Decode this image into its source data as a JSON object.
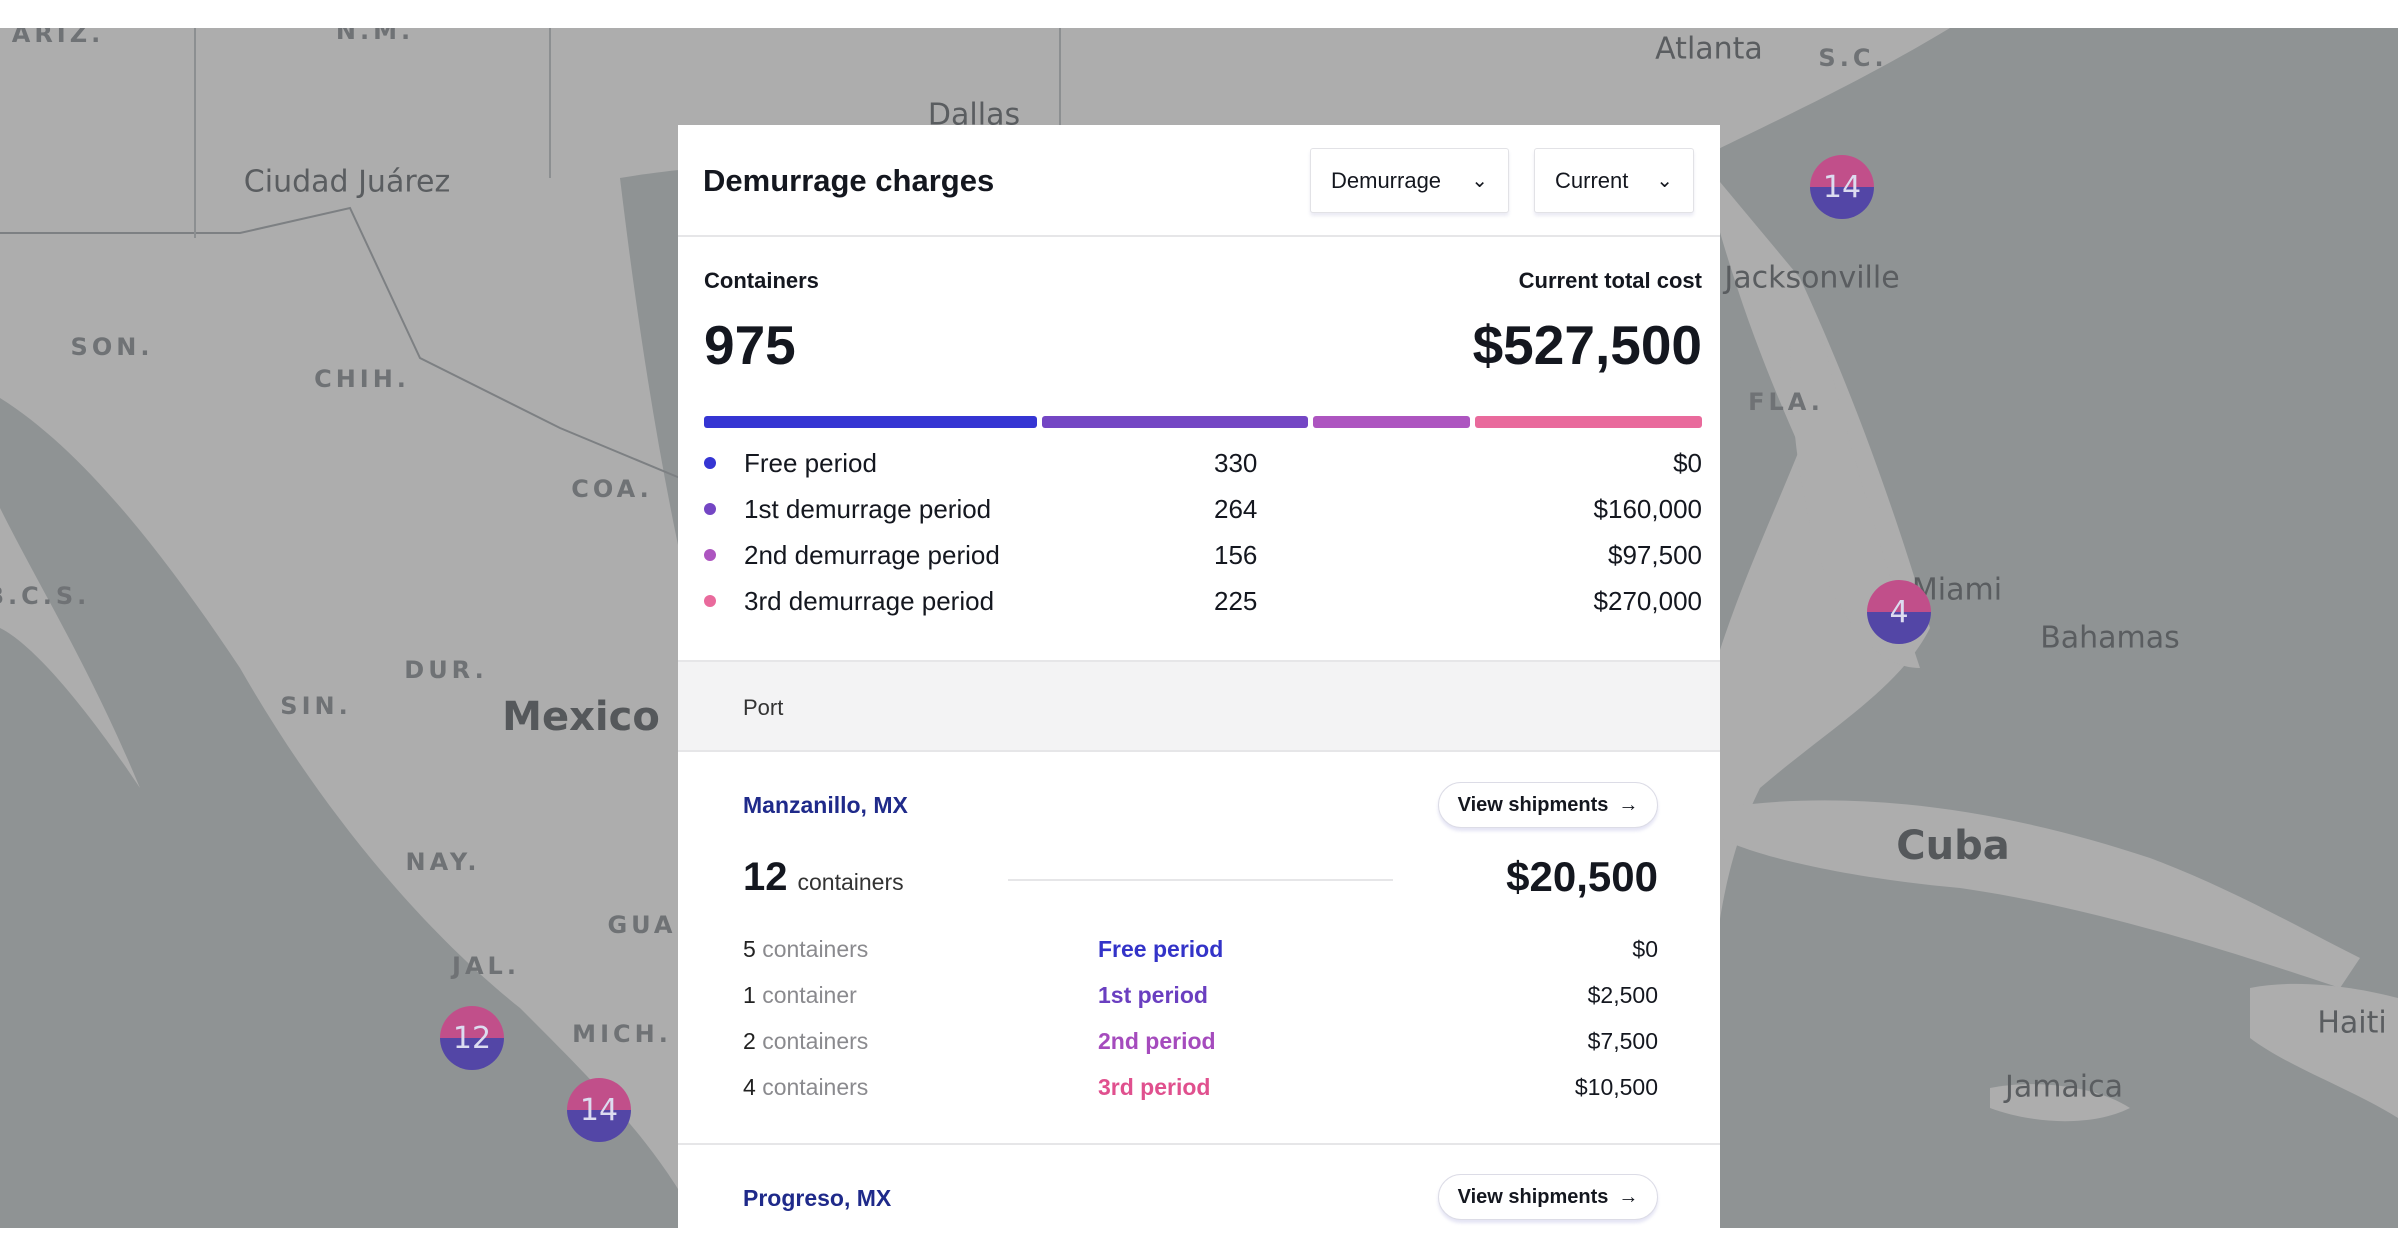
{
  "map": {
    "labels": [
      {
        "text": "ARIZ.",
        "kind": "state"
      },
      {
        "text": "N.M.",
        "kind": "state"
      },
      {
        "text": "Dallas",
        "kind": "city"
      },
      {
        "text": "Atlanta",
        "kind": "city"
      },
      {
        "text": "S.C.",
        "kind": "state"
      },
      {
        "text": "Ciudad Juárez",
        "kind": "city"
      },
      {
        "text": "Jacksonville",
        "kind": "city"
      },
      {
        "text": "SON.",
        "kind": "state"
      },
      {
        "text": "CHIH.",
        "kind": "state"
      },
      {
        "text": "FLA.",
        "kind": "state"
      },
      {
        "text": "COA.",
        "kind": "state"
      },
      {
        "text": "B.C.S.",
        "kind": "state"
      },
      {
        "text": "Miami",
        "kind": "city"
      },
      {
        "text": "Bahamas",
        "kind": "city"
      },
      {
        "text": "DUR.",
        "kind": "state"
      },
      {
        "text": "SIN.",
        "kind": "state"
      },
      {
        "text": "Mexico",
        "kind": "country"
      },
      {
        "text": "Cuba",
        "kind": "country"
      },
      {
        "text": "NAY.",
        "kind": "state"
      },
      {
        "text": "GUA",
        "kind": "state"
      },
      {
        "text": "JAL.",
        "kind": "state"
      },
      {
        "text": "MICH.",
        "kind": "state"
      },
      {
        "text": "Haiti",
        "kind": "city"
      },
      {
        "text": "Jamaica",
        "kind": "city"
      }
    ],
    "clusters": [
      {
        "count": "14"
      },
      {
        "count": "4"
      },
      {
        "count": "12"
      },
      {
        "count": "14"
      }
    ]
  },
  "panel": {
    "title": "Demurrage charges",
    "type_dropdown": "Demurrage",
    "time_dropdown": "Current",
    "containers_label": "Containers",
    "containers_total": "975",
    "cost_label": "Current total cost",
    "cost_total": "$527,500",
    "periods": [
      {
        "label": "Free period",
        "count": "330",
        "cost": "$0",
        "color": "#3535d3",
        "share": 330
      },
      {
        "label": "1st demurrage period",
        "count": "264",
        "cost": "$160,000",
        "color": "#7446c4",
        "share": 264
      },
      {
        "label": "2nd demurrage period",
        "count": "156",
        "cost": "$97,500",
        "color": "#ad55c0",
        "share": 156
      },
      {
        "label": "3rd demurrage period",
        "count": "225",
        "cost": "$270,000",
        "color": "#e96a9c",
        "share": 225
      }
    ],
    "port_header": "Port",
    "ports": [
      {
        "name": "Manzanillo, MX",
        "button": "View shipments",
        "containers": "12",
        "containers_unit": "containers",
        "total": "$20,500",
        "rows": [
          {
            "n": "5",
            "unit": "containers",
            "period": "Free period",
            "cost": "$0",
            "color": "#3333c8"
          },
          {
            "n": "1",
            "unit": "container",
            "period": "1st period",
            "cost": "$2,500",
            "color": "#6a3fc0"
          },
          {
            "n": "2",
            "unit": "containers",
            "period": "2nd period",
            "cost": "$7,500",
            "color": "#a54bbd"
          },
          {
            "n": "4",
            "unit": "containers",
            "period": "3rd period",
            "cost": "$10,500",
            "color": "#e0508e"
          }
        ]
      },
      {
        "name": "Progreso, MX",
        "button": "View shipments"
      }
    ]
  }
}
